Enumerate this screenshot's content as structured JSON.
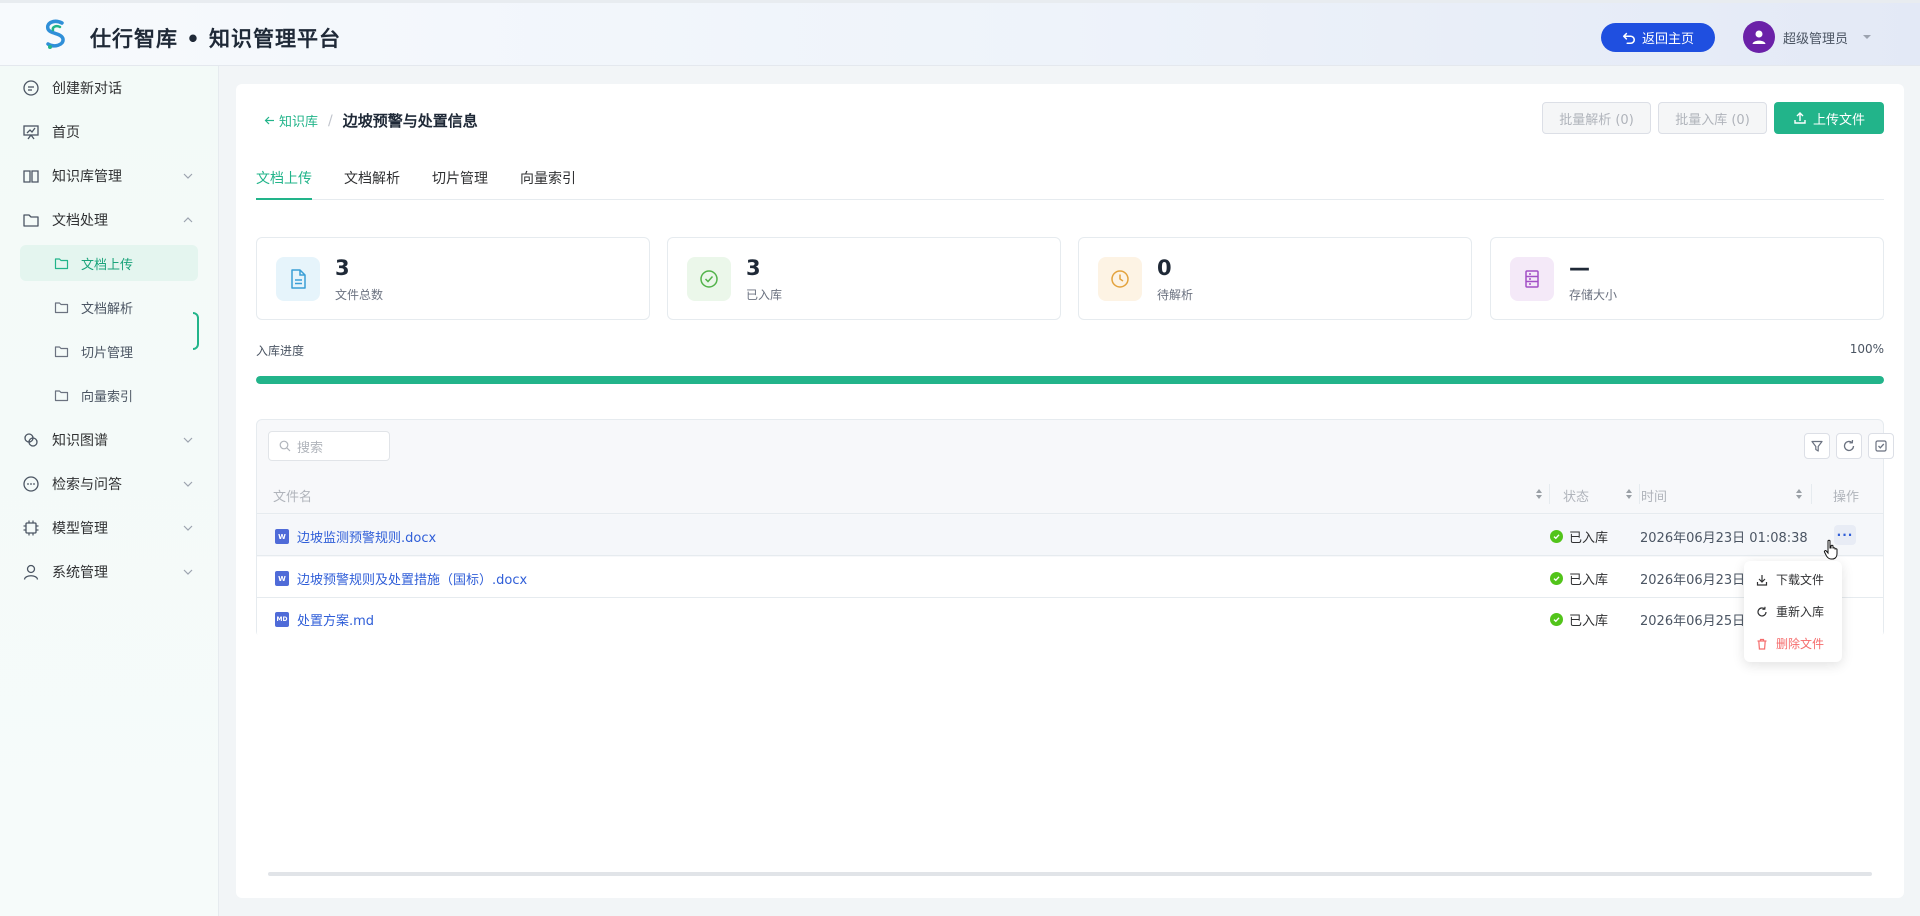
{
  "header": {
    "app_title": "仕行智库 • 知识管理平台",
    "home_button": "返回主页",
    "user_name": "超级管理员",
    "brand_color": "#1f4fe0"
  },
  "sidebar": {
    "items": [
      {
        "label": "创建新对话",
        "icon": "chat-icon"
      },
      {
        "label": "首页",
        "icon": "presentation-icon"
      },
      {
        "label": "知识库管理",
        "icon": "book-icon"
      },
      {
        "label": "文档处理",
        "icon": "folder-icon"
      },
      {
        "label": "知识图谱",
        "icon": "graph-icon"
      },
      {
        "label": "检索与问答",
        "icon": "chat-search-icon"
      },
      {
        "label": "模型管理",
        "icon": "chip-icon"
      },
      {
        "label": "系统管理",
        "icon": "user-icon"
      }
    ],
    "sub_items": [
      {
        "label": "文档上传"
      },
      {
        "label": "文档解析"
      },
      {
        "label": "切片管理"
      },
      {
        "label": "向量索引"
      }
    ],
    "active_color": "#22b48a"
  },
  "breadcrumb": {
    "back": "知识库",
    "separator": "/",
    "current": "边坡预警与处置信息"
  },
  "actions": {
    "batch_parse": "批量解析 (0)",
    "batch_import": "批量入库 (0)",
    "upload": "上传文件"
  },
  "tabs": [
    "文档上传",
    "文档解析",
    "切片管理",
    "向量索引"
  ],
  "stats": [
    {
      "value": "3",
      "label": "文件总数",
      "icon": "document-icon"
    },
    {
      "value": "3",
      "label": "已入库",
      "icon": "check-circle-icon"
    },
    {
      "value": "0",
      "label": "待解析",
      "icon": "clock-icon"
    },
    {
      "value": "—",
      "label": "存储大小",
      "icon": "storage-icon"
    }
  ],
  "progress": {
    "label": "入库进度",
    "percent_text": "100%",
    "percent": 100
  },
  "table": {
    "search_placeholder": "搜索",
    "columns": {
      "name": "文件名",
      "status": "状态",
      "time": "时间",
      "action": "操作"
    },
    "rows": [
      {
        "name": "边坡监测预警规则.docx",
        "type": "W",
        "status": "已入库",
        "time": "2026年06月23日 01:08:38"
      },
      {
        "name": "边坡预警规则及处置措施（国标）.docx",
        "type": "W",
        "status": "已入库",
        "time": "2026年06月23日"
      },
      {
        "name": "处置方案.md",
        "type": "MD",
        "status": "已入库",
        "time": "2026年06月25日"
      }
    ],
    "more_label": "···"
  },
  "row_menu": {
    "items": [
      {
        "label": "下载文件",
        "icon": "download-icon"
      },
      {
        "label": "重新入库",
        "icon": "refresh-icon"
      },
      {
        "label": "删除文件",
        "icon": "trash-icon"
      }
    ]
  }
}
